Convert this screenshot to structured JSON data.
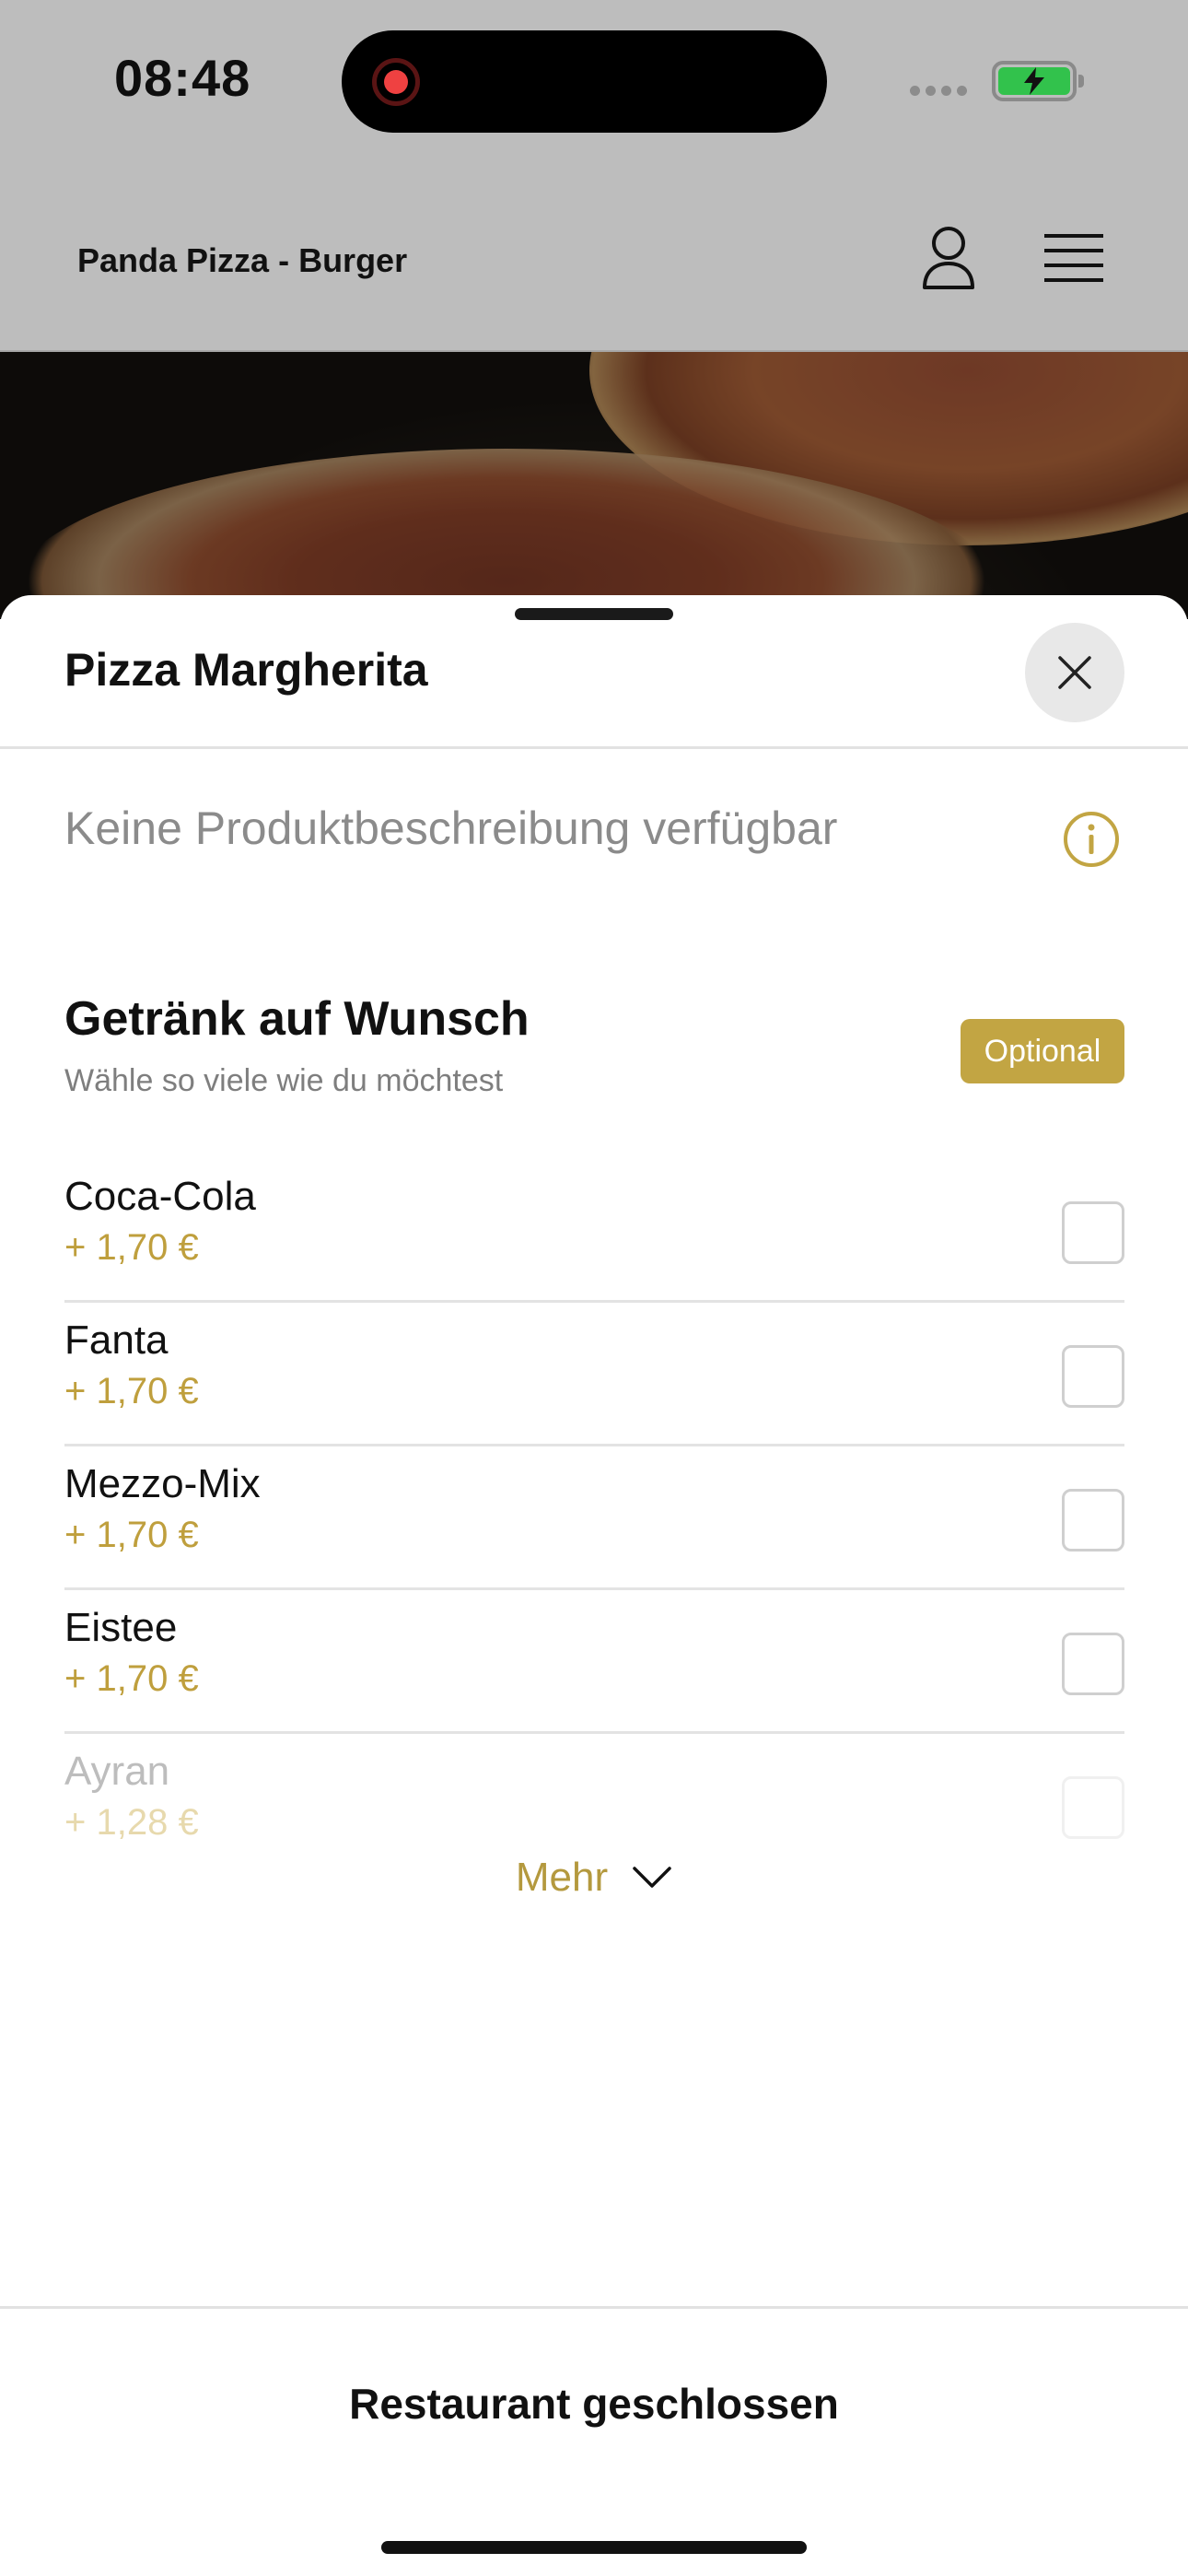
{
  "status_bar": {
    "time": "08:48"
  },
  "header": {
    "restaurant_name": "Panda Pizza - Burger",
    "profile_icon": "person-icon",
    "menu_icon": "hamburger-menu-icon"
  },
  "sheet": {
    "title": "Pizza Margherita",
    "close_icon": "close-icon",
    "description": "Keine Produktbeschreibung verfügbar",
    "info_icon": "info-icon",
    "group": {
      "title": "Getränk auf Wunsch",
      "subtitle": "Wähle so viele wie du möchtest",
      "badge": "Optional",
      "options": [
        {
          "name": "Coca-Cola",
          "price": "+ 1,70 €"
        },
        {
          "name": "Fanta",
          "price": "+ 1,70 €"
        },
        {
          "name": "Mezzo-Mix",
          "price": "+ 1,70 €"
        },
        {
          "name": "Eistee",
          "price": "+ 1,70 €"
        },
        {
          "name": "Ayran",
          "price": "+ 1,28 €"
        }
      ]
    },
    "more_label": "Mehr",
    "footer_label": "Restaurant geschlossen"
  },
  "colors": {
    "accent_gold": "#c2a543",
    "overlay_gray": "#bdbdbd",
    "battery_green": "#32c24c"
  }
}
